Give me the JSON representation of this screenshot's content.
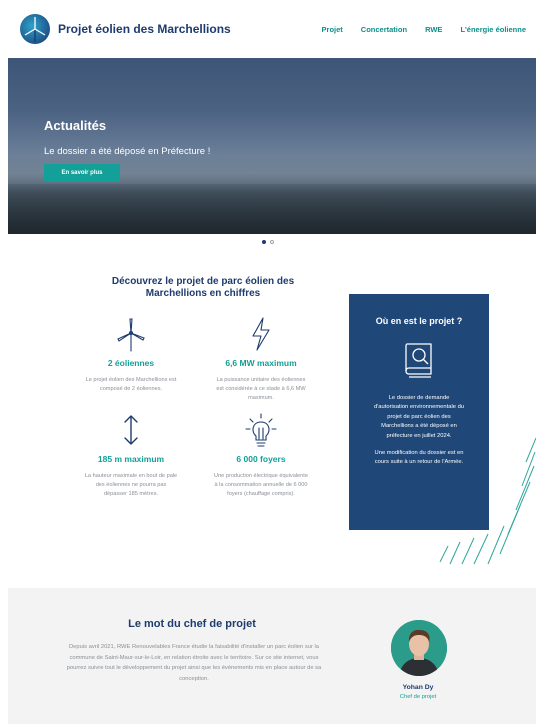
{
  "header": {
    "site_title": "Projet éolien des Marchellions",
    "nav": [
      "Projet",
      "Concertation",
      "RWE",
      "L'énergie éolienne"
    ]
  },
  "hero": {
    "title": "Actualités",
    "subtitle": "Le dossier a été déposé en Préfecture !",
    "button_label": "En savoir plus",
    "slides_total": 2,
    "slide_active": 1
  },
  "figures": {
    "title": "Découvrez le projet de parc éolien des Marchellions en chiffres",
    "items": [
      {
        "icon": "wind-turbine-icon",
        "value": "2 éoliennes",
        "desc": "Le projet éolien des Marchellions est composé de 2 éoliennes."
      },
      {
        "icon": "lightning-icon",
        "value": "6,6 MW maximum",
        "desc": "La puissance unitaire des éoliennes est considérée à ce stade à 6,6 MW maximum."
      },
      {
        "icon": "height-arrow-icon",
        "value": "185 m maximum",
        "desc": "La hauteur maximale en bout de pale des éoliennes ne pourra pas dépasser 185 mètres."
      },
      {
        "icon": "light-bulb-icon",
        "value": "6 000 foyers",
        "desc": "Une production électrique équivalente à la consommation annuelle de 6 000 foyers (chauffage compris)."
      }
    ]
  },
  "project_status": {
    "title": "Où en est le projet ?",
    "icon": "document-search-icon",
    "text1": "Le dossier de demande d'autorisation environnementale du projet de parc éolien des Marchellions a été déposé en préfecture en juillet 2024.",
    "text2": "Une modification du dossier est en cours suite à un retour de l'Armée."
  },
  "chief": {
    "title": "Le mot du chef de projet",
    "text": "Depuis avril 2021, RWE Renouvelables France étudie la faisabilité d'installer un parc éolien sur la commune de Saint-Maur-sur-le-Loir, en relation étroite avec le territoire. Sur ce site internet, vous pourrez suivre tout le développement du projet ainsi que les évènements mis en place autour de sa conception.",
    "name": "Yohan Dy",
    "role": "Chef de projet"
  },
  "colors": {
    "navy": "#1d3b6e",
    "teal": "#12a098",
    "box": "#1f4778"
  }
}
